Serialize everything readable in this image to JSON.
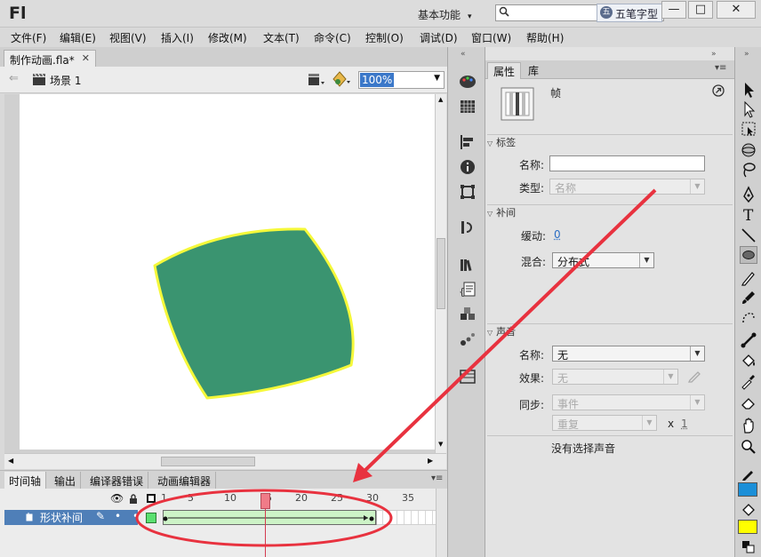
{
  "app": {
    "logo": "Fl",
    "workspace": "基本功能",
    "ime_label": "五笔字型",
    "window_buttons": [
      "—",
      "□",
      "✕"
    ]
  },
  "menu": [
    "文件(F)",
    "编辑(E)",
    "视图(V)",
    "插入(I)",
    "修改(M)",
    "文本(T)",
    "命令(C)",
    "控制(O)",
    "调试(D)",
    "窗口(W)",
    "帮助(H)"
  ],
  "document": {
    "tab_title": "制作动画.fla*",
    "scene_name": "场景 1",
    "zoom": "100%"
  },
  "timeline": {
    "tabs": [
      "时间轴",
      "输出",
      "编译器错误",
      "动画编辑器"
    ],
    "frame_numbers": [
      "1",
      "5",
      "10",
      "15",
      "20",
      "25",
      "30",
      "35"
    ],
    "current_frame": 15,
    "tween_start": 1,
    "tween_end": 30,
    "layer_name": "形状补间"
  },
  "properties": {
    "tabs": [
      "属性",
      "库"
    ],
    "object_type": "帧",
    "label_section": "标签",
    "name_label": "名称:",
    "name_value": "",
    "type_label": "类型:",
    "type_value": "名称",
    "tween_section": "补间",
    "ease_label": "缓动:",
    "ease_value": "0",
    "blend_label": "混合:",
    "blend_value": "分布式",
    "sound_section": "声音",
    "sound_name_label": "名称:",
    "sound_name_value": "无",
    "effect_label": "效果:",
    "effect_value": "无",
    "sync_label": "同步:",
    "sync_value": "事件",
    "repeat_value": "重复",
    "repeat_x": "x",
    "repeat_count": "1",
    "no_sound": "没有选择声音"
  },
  "colors": {
    "shape_fill": "#3a9470",
    "shape_stroke": "#f5f83a",
    "fill_swatch": "#ffff00",
    "stroke_swatch": "#1b8fd8",
    "annotation": "#e8323f"
  }
}
